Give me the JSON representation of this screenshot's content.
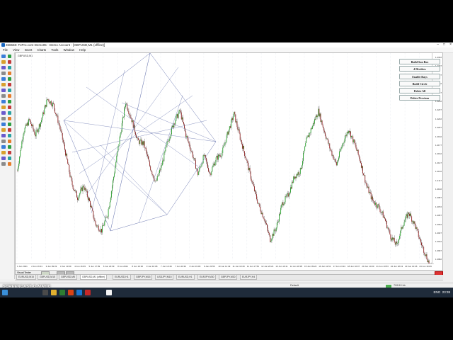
{
  "window": {
    "title": "366558: FxPro.com-Demo05 - Demo Account - [GBPUSD,M1 (offline)]",
    "minimize": "–",
    "maximize": "□",
    "close": "×"
  },
  "menu": [
    "File",
    "View",
    "Insert",
    "Charts",
    "Tools",
    "Window",
    "Help"
  ],
  "chart": {
    "symbol_label": "GBPUSD,M1"
  },
  "price_scale": [
    "1.4322",
    "1.4307",
    "1.4297",
    "1.4282",
    "1.4267",
    "1.4252",
    "1.4237",
    "1.4222",
    "1.4207",
    "1.4192",
    "1.4177",
    "1.4162",
    "1.4147",
    "1.4132",
    "1.4117",
    "1.4102",
    "1.4087",
    "1.4072",
    "1.4057",
    "1.4042",
    "1.4027",
    "1.4012",
    "1.3997",
    "1.3982"
  ],
  "time_axis": [
    "1 Jun 2021",
    "2 Jun 16:31",
    "3 Jun 09:49",
    "3 Jun 13:09",
    "4 Jun 16:09",
    "5 Jun 17:09",
    "6 Jun 23:39",
    "8 Jun 2021",
    "8 Jun 19:30",
    "9 Jun 16:08",
    "7 Jun 13:49",
    "7 Jun 20:32",
    "8 Jun 19:09",
    "9 Jun 20:56",
    "10 Jun 11:49",
    "11 Jun 10:49",
    "11 Jun 17:53",
    "12 Jun 20:21",
    "13 Jun 16:11",
    "14 Jun 18:35",
    "15 Jun 09:22",
    "16 Jun 11:51",
    "17 Jun 13:24",
    "18 Jun 10:07",
    "20 Jun 10:20",
    "21 Jun 13:53",
    "22 Jun 18:43",
    "23 Jun 13:46",
    "24 Jun 19:09"
  ],
  "panel_buttons": [
    "Build Sun Box",
    "4 Dividers",
    "Enable Rays",
    "Build Circle",
    "Delete All",
    "Delete Previous"
  ],
  "strip": {
    "label": "Visual Tester"
  },
  "tabs": [
    "EURUSD,M15",
    "GBPUSD,M15",
    "GBPUSD,M5",
    "GBPUSD,M1 (offline)",
    "EURUSD,H1",
    "GBPJPY,M15",
    "USDJPY,M15",
    "EURUSD,H1",
    "EURJPY,M30",
    "GBPJPY,M30",
    "EURJPY,H4"
  ],
  "status": {
    "profile": "Default",
    "memory": "799/10 kb"
  },
  "taskbar": {
    "lang": "ENG",
    "time": "23:38"
  },
  "watermark": "SCREENCAST-O-MATIC",
  "chart_data": {
    "type": "candlestick",
    "ylim": [
      1.3982,
      1.4322
    ],
    "title": "",
    "xlabel": "",
    "ylabel": "",
    "price_path": [
      1.413,
      1.4195,
      1.4215,
      1.419,
      1.4215,
      1.425,
      1.424,
      1.4205,
      1.416,
      1.411,
      1.4085,
      1.4105,
      1.4078,
      1.404,
      1.403,
      1.4058,
      1.412,
      1.4185,
      1.4245,
      1.4215,
      1.418,
      1.4175,
      1.4138,
      1.411,
      1.414,
      1.418,
      1.421,
      1.423,
      1.419,
      1.416,
      1.4125,
      1.4155,
      1.4125,
      1.415,
      1.416,
      1.4195,
      1.4225,
      1.4185,
      1.415,
      1.411,
      1.4075,
      1.405,
      1.4015,
      1.4035,
      1.4075,
      1.409,
      1.412,
      1.413,
      1.418,
      1.4205,
      1.423,
      1.4195,
      1.4165,
      1.414,
      1.4175,
      1.42,
      1.4175,
      1.4145,
      1.4105,
      1.408,
      1.407,
      1.405,
      1.402,
      1.4005,
      1.404,
      1.406,
      1.404,
      1.401,
      1.3985,
      1.396
    ],
    "colors": {
      "bull": "#1e9e22",
      "bear": "#8b1a1a",
      "wick": "#333333",
      "grid": "#d8dde6",
      "pattern": "#6f7bb3"
    }
  }
}
